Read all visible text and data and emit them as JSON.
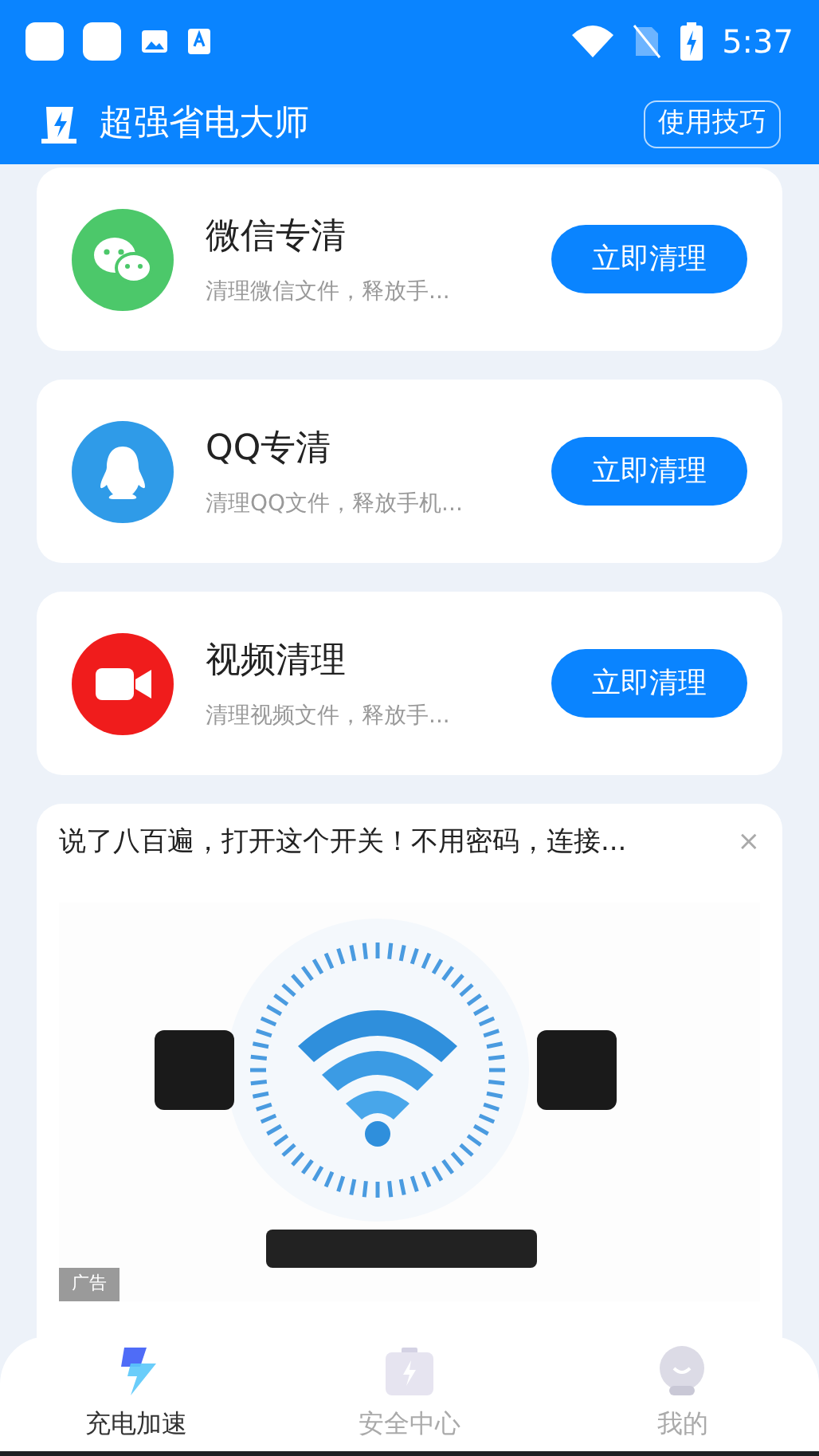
{
  "status_bar": {
    "time": "5:37"
  },
  "header": {
    "title": "超强省电大师",
    "tips_button": "使用技巧"
  },
  "cleaners": [
    {
      "kind": "wechat",
      "title": "微信专清",
      "subtitle": "清理微信文件，释放手...",
      "button": "立即清理"
    },
    {
      "kind": "qq",
      "title": "QQ专清",
      "subtitle": "清理QQ文件，释放手机...",
      "button": "立即清理"
    },
    {
      "kind": "video",
      "title": "视频清理",
      "subtitle": "清理视频文件，释放手...",
      "button": "立即清理"
    }
  ],
  "ad": {
    "headline": "说了八百遍，打开这个开关！不用密码，连接...",
    "close": "×",
    "tag": "广告"
  },
  "bottom_nav": [
    {
      "kind": "bolt",
      "label": "充电加速",
      "selected": true
    },
    {
      "kind": "battery",
      "label": "安全中心",
      "selected": false
    },
    {
      "kind": "face",
      "label": "我的",
      "selected": false
    }
  ]
}
